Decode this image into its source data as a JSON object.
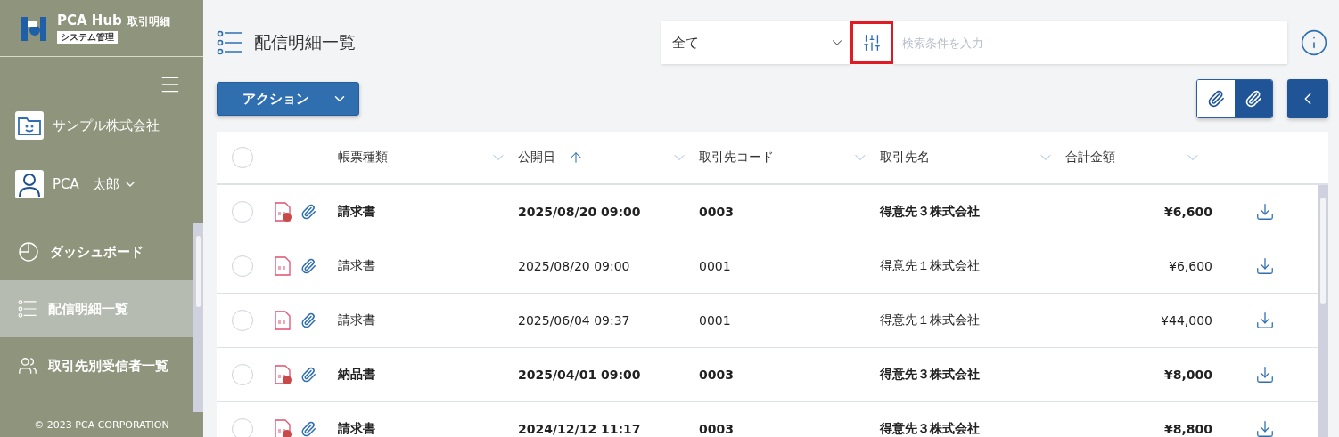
{
  "sidebar": {
    "logo": {
      "brand": "PCA Hub",
      "product": "取引明細",
      "badge": "システム管理"
    },
    "company": "サンプル株式会社",
    "user": "PCA　太郎",
    "nav": [
      {
        "label": "ダッシュボード",
        "kind": "dashboard",
        "selected": false
      },
      {
        "label": "配信明細一覧",
        "kind": "list",
        "selected": true
      },
      {
        "label": "取引先別受信者一覧",
        "kind": "people",
        "selected": false
      }
    ],
    "footer": "© 2023 PCA CORPORATION"
  },
  "page": {
    "title": "配信明細一覧"
  },
  "filter": {
    "scope": "全て",
    "filter_button_highlighted": true,
    "placeholder": "検索条件を入力"
  },
  "action_button": "アクション",
  "attachment_toggle": [
    {
      "selected": false
    },
    {
      "selected": true
    }
  ],
  "table": {
    "select_all": {
      "selected": false
    },
    "columns": [
      {
        "label": "帳票種類",
        "sorted": false
      },
      {
        "label": "公開日",
        "sorted": true
      },
      {
        "label": "取引先コード",
        "sorted": false
      },
      {
        "label": "取引先名",
        "sorted": false
      },
      {
        "label": "合計金額",
        "sorted": false
      }
    ],
    "rows": [
      {
        "selected": false,
        "unread": true,
        "type": "請求書",
        "date": "2025/08/20 09:00",
        "code": "0003",
        "partner": "得意先３株式会社",
        "amount": "¥6,600"
      },
      {
        "selected": false,
        "unread": false,
        "type": "請求書",
        "date": "2025/08/20 09:00",
        "code": "0001",
        "partner": "得意先１株式会社",
        "amount": "¥6,600"
      },
      {
        "selected": false,
        "unread": false,
        "type": "請求書",
        "date": "2025/06/04 09:37",
        "code": "0001",
        "partner": "得意先１株式会社",
        "amount": "¥44,000"
      },
      {
        "selected": false,
        "unread": true,
        "type": "納品書",
        "date": "2025/04/01 09:00",
        "code": "0003",
        "partner": "得意先３株式会社",
        "amount": "¥8,000"
      },
      {
        "selected": false,
        "unread": true,
        "type": "請求書",
        "date": "2024/12/12 11:17",
        "code": "0003",
        "partner": "得意先３株式会社",
        "amount": "¥8,800"
      }
    ]
  }
}
